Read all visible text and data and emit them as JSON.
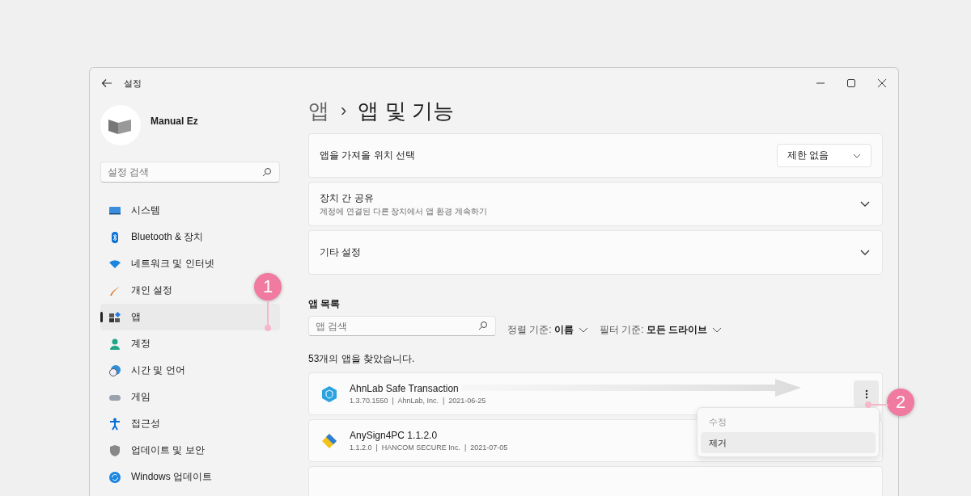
{
  "window": {
    "title": "설정"
  },
  "profile": {
    "name": "Manual Ez"
  },
  "sidebar": {
    "search": {
      "placeholder": "설정 검색"
    },
    "items": [
      {
        "label": "시스템",
        "selected": false
      },
      {
        "label": "Bluetooth & 장치",
        "selected": false
      },
      {
        "label": "네트워크 및 인터넷",
        "selected": false
      },
      {
        "label": "개인 설정",
        "selected": false
      },
      {
        "label": "앱",
        "selected": true
      },
      {
        "label": "계정",
        "selected": false
      },
      {
        "label": "시간 및 언어",
        "selected": false
      },
      {
        "label": "게임",
        "selected": false
      },
      {
        "label": "접근성",
        "selected": false
      },
      {
        "label": "업데이트 및 보안",
        "selected": false
      },
      {
        "label": "Windows 업데이트",
        "selected": false
      }
    ]
  },
  "breadcrumb": {
    "parent": "앱",
    "separator": "›",
    "current": "앱 및 기능"
  },
  "settings_cards": [
    {
      "kind": "dropdown",
      "title": "앱을 가져올 위치 선택",
      "value": "제한 없음"
    },
    {
      "kind": "expander",
      "title": "장치 간 공유",
      "subtitle": "계정에 연결된 다른 장치에서 앱 환경 계속하기",
      "expanded": false
    },
    {
      "kind": "expander",
      "title": "기타 설정",
      "expanded": false
    }
  ],
  "app_list": {
    "heading": "앱 목록",
    "search": {
      "placeholder": "앱 검색"
    },
    "sort": {
      "label": "정렬 기준:",
      "value": "이름"
    },
    "filter": {
      "label": "필터 기준:",
      "value": "모든 드라이브"
    },
    "count": "53개의 앱을 찾았습니다.",
    "apps": [
      {
        "name": "AhnLab Safe Transaction",
        "details": "1.3.70.1550  |  AhnLab, Inc.  |  2021-06-25"
      },
      {
        "name": "AnySign4PC 1.1.2.0",
        "details": "1.1.2.0  |  HANCOM SECURE Inc.  |  2021-07-05"
      }
    ],
    "context_menu": {
      "items": [
        {
          "label": "수정",
          "disabled": true,
          "selected": false
        },
        {
          "label": "제거",
          "disabled": false,
          "selected": true
        }
      ]
    }
  },
  "callouts": [
    {
      "label": "1"
    },
    {
      "label": "2"
    }
  ]
}
